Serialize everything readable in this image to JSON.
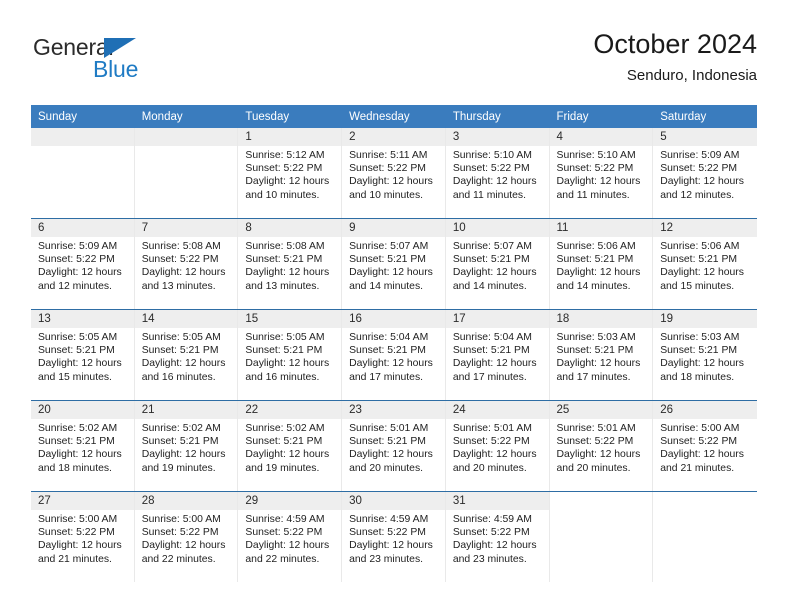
{
  "brand": {
    "name_part1": "General",
    "name_part2": "Blue",
    "triangle_color": "#1f6fb5",
    "blue_text_color": "#1f7bc4"
  },
  "header": {
    "title": "October 2024",
    "subtitle": "Senduro, Indonesia"
  },
  "theme": {
    "header_row_bg": "#3a7cbe",
    "header_row_text": "#ffffff",
    "week_divider": "#2e6da4",
    "daynum_band_bg": "#eeeeee",
    "cell_divider": "#e9e9e9"
  },
  "weekday_headers": [
    "Sunday",
    "Monday",
    "Tuesday",
    "Wednesday",
    "Thursday",
    "Friday",
    "Saturday"
  ],
  "labels": {
    "sunrise_prefix": "Sunrise:",
    "sunset_prefix": "Sunset:",
    "daylight_prefix": "Daylight:"
  },
  "weeks": [
    [
      {
        "day": "",
        "sunrise": "",
        "sunset": "",
        "daylight_line1": "",
        "daylight_line2": "",
        "empty": true
      },
      {
        "day": "",
        "sunrise": "",
        "sunset": "",
        "daylight_line1": "",
        "daylight_line2": "",
        "empty": true
      },
      {
        "day": "1",
        "sunrise": "Sunrise: 5:12 AM",
        "sunset": "Sunset: 5:22 PM",
        "daylight_line1": "Daylight: 12 hours",
        "daylight_line2": "and 10 minutes."
      },
      {
        "day": "2",
        "sunrise": "Sunrise: 5:11 AM",
        "sunset": "Sunset: 5:22 PM",
        "daylight_line1": "Daylight: 12 hours",
        "daylight_line2": "and 10 minutes."
      },
      {
        "day": "3",
        "sunrise": "Sunrise: 5:10 AM",
        "sunset": "Sunset: 5:22 PM",
        "daylight_line1": "Daylight: 12 hours",
        "daylight_line2": "and 11 minutes."
      },
      {
        "day": "4",
        "sunrise": "Sunrise: 5:10 AM",
        "sunset": "Sunset: 5:22 PM",
        "daylight_line1": "Daylight: 12 hours",
        "daylight_line2": "and 11 minutes."
      },
      {
        "day": "5",
        "sunrise": "Sunrise: 5:09 AM",
        "sunset": "Sunset: 5:22 PM",
        "daylight_line1": "Daylight: 12 hours",
        "daylight_line2": "and 12 minutes."
      }
    ],
    [
      {
        "day": "6",
        "sunrise": "Sunrise: 5:09 AM",
        "sunset": "Sunset: 5:22 PM",
        "daylight_line1": "Daylight: 12 hours",
        "daylight_line2": "and 12 minutes."
      },
      {
        "day": "7",
        "sunrise": "Sunrise: 5:08 AM",
        "sunset": "Sunset: 5:22 PM",
        "daylight_line1": "Daylight: 12 hours",
        "daylight_line2": "and 13 minutes."
      },
      {
        "day": "8",
        "sunrise": "Sunrise: 5:08 AM",
        "sunset": "Sunset: 5:21 PM",
        "daylight_line1": "Daylight: 12 hours",
        "daylight_line2": "and 13 minutes."
      },
      {
        "day": "9",
        "sunrise": "Sunrise: 5:07 AM",
        "sunset": "Sunset: 5:21 PM",
        "daylight_line1": "Daylight: 12 hours",
        "daylight_line2": "and 14 minutes."
      },
      {
        "day": "10",
        "sunrise": "Sunrise: 5:07 AM",
        "sunset": "Sunset: 5:21 PM",
        "daylight_line1": "Daylight: 12 hours",
        "daylight_line2": "and 14 minutes."
      },
      {
        "day": "11",
        "sunrise": "Sunrise: 5:06 AM",
        "sunset": "Sunset: 5:21 PM",
        "daylight_line1": "Daylight: 12 hours",
        "daylight_line2": "and 14 minutes."
      },
      {
        "day": "12",
        "sunrise": "Sunrise: 5:06 AM",
        "sunset": "Sunset: 5:21 PM",
        "daylight_line1": "Daylight: 12 hours",
        "daylight_line2": "and 15 minutes."
      }
    ],
    [
      {
        "day": "13",
        "sunrise": "Sunrise: 5:05 AM",
        "sunset": "Sunset: 5:21 PM",
        "daylight_line1": "Daylight: 12 hours",
        "daylight_line2": "and 15 minutes."
      },
      {
        "day": "14",
        "sunrise": "Sunrise: 5:05 AM",
        "sunset": "Sunset: 5:21 PM",
        "daylight_line1": "Daylight: 12 hours",
        "daylight_line2": "and 16 minutes."
      },
      {
        "day": "15",
        "sunrise": "Sunrise: 5:05 AM",
        "sunset": "Sunset: 5:21 PM",
        "daylight_line1": "Daylight: 12 hours",
        "daylight_line2": "and 16 minutes."
      },
      {
        "day": "16",
        "sunrise": "Sunrise: 5:04 AM",
        "sunset": "Sunset: 5:21 PM",
        "daylight_line1": "Daylight: 12 hours",
        "daylight_line2": "and 17 minutes."
      },
      {
        "day": "17",
        "sunrise": "Sunrise: 5:04 AM",
        "sunset": "Sunset: 5:21 PM",
        "daylight_line1": "Daylight: 12 hours",
        "daylight_line2": "and 17 minutes."
      },
      {
        "day": "18",
        "sunrise": "Sunrise: 5:03 AM",
        "sunset": "Sunset: 5:21 PM",
        "daylight_line1": "Daylight: 12 hours",
        "daylight_line2": "and 17 minutes."
      },
      {
        "day": "19",
        "sunrise": "Sunrise: 5:03 AM",
        "sunset": "Sunset: 5:21 PM",
        "daylight_line1": "Daylight: 12 hours",
        "daylight_line2": "and 18 minutes."
      }
    ],
    [
      {
        "day": "20",
        "sunrise": "Sunrise: 5:02 AM",
        "sunset": "Sunset: 5:21 PM",
        "daylight_line1": "Daylight: 12 hours",
        "daylight_line2": "and 18 minutes."
      },
      {
        "day": "21",
        "sunrise": "Sunrise: 5:02 AM",
        "sunset": "Sunset: 5:21 PM",
        "daylight_line1": "Daylight: 12 hours",
        "daylight_line2": "and 19 minutes."
      },
      {
        "day": "22",
        "sunrise": "Sunrise: 5:02 AM",
        "sunset": "Sunset: 5:21 PM",
        "daylight_line1": "Daylight: 12 hours",
        "daylight_line2": "and 19 minutes."
      },
      {
        "day": "23",
        "sunrise": "Sunrise: 5:01 AM",
        "sunset": "Sunset: 5:21 PM",
        "daylight_line1": "Daylight: 12 hours",
        "daylight_line2": "and 20 minutes."
      },
      {
        "day": "24",
        "sunrise": "Sunrise: 5:01 AM",
        "sunset": "Sunset: 5:22 PM",
        "daylight_line1": "Daylight: 12 hours",
        "daylight_line2": "and 20 minutes."
      },
      {
        "day": "25",
        "sunrise": "Sunrise: 5:01 AM",
        "sunset": "Sunset: 5:22 PM",
        "daylight_line1": "Daylight: 12 hours",
        "daylight_line2": "and 20 minutes."
      },
      {
        "day": "26",
        "sunrise": "Sunrise: 5:00 AM",
        "sunset": "Sunset: 5:22 PM",
        "daylight_line1": "Daylight: 12 hours",
        "daylight_line2": "and 21 minutes."
      }
    ],
    [
      {
        "day": "27",
        "sunrise": "Sunrise: 5:00 AM",
        "sunset": "Sunset: 5:22 PM",
        "daylight_line1": "Daylight: 12 hours",
        "daylight_line2": "and 21 minutes."
      },
      {
        "day": "28",
        "sunrise": "Sunrise: 5:00 AM",
        "sunset": "Sunset: 5:22 PM",
        "daylight_line1": "Daylight: 12 hours",
        "daylight_line2": "and 22 minutes."
      },
      {
        "day": "29",
        "sunrise": "Sunrise: 4:59 AM",
        "sunset": "Sunset: 5:22 PM",
        "daylight_line1": "Daylight: 12 hours",
        "daylight_line2": "and 22 minutes."
      },
      {
        "day": "30",
        "sunrise": "Sunrise: 4:59 AM",
        "sunset": "Sunset: 5:22 PM",
        "daylight_line1": "Daylight: 12 hours",
        "daylight_line2": "and 23 minutes."
      },
      {
        "day": "31",
        "sunrise": "Sunrise: 4:59 AM",
        "sunset": "Sunset: 5:22 PM",
        "daylight_line1": "Daylight: 12 hours",
        "daylight_line2": "and 23 minutes."
      },
      {
        "day": "",
        "sunrise": "",
        "sunset": "",
        "daylight_line1": "",
        "daylight_line2": "",
        "empty": true,
        "blank": true
      },
      {
        "day": "",
        "sunrise": "",
        "sunset": "",
        "daylight_line1": "",
        "daylight_line2": "",
        "empty": true,
        "blank": true
      }
    ]
  ]
}
